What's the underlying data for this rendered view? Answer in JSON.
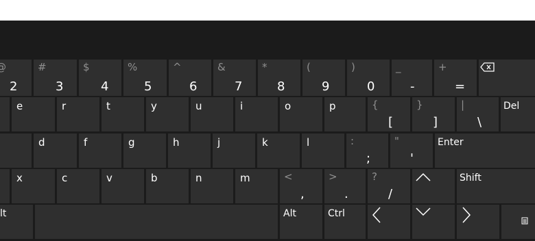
{
  "colors": {
    "background": "#1b1b1b",
    "key": "#2f2f2f",
    "text": "#ffffff",
    "secondary_text": "#8f8f8f"
  },
  "row1": [
    {
      "shift": "@",
      "main": "2"
    },
    {
      "shift": "#",
      "main": "3"
    },
    {
      "shift": "$",
      "main": "4"
    },
    {
      "shift": "%",
      "main": "5"
    },
    {
      "shift": "^",
      "main": "6"
    },
    {
      "shift": "&",
      "main": "7"
    },
    {
      "shift": "*",
      "main": "8"
    },
    {
      "shift": "(",
      "main": "9"
    },
    {
      "shift": ")",
      "main": "0"
    },
    {
      "shift": "_",
      "main": "-"
    },
    {
      "shift": "+",
      "main": "="
    }
  ],
  "backspace_icon": "backspace-icon",
  "row2": [
    "e",
    "r",
    "t",
    "y",
    "u",
    "i",
    "o",
    "p"
  ],
  "row2_symbols": [
    {
      "shift": "{",
      "main": "["
    },
    {
      "shift": "}",
      "main": "]"
    },
    {
      "shift": "|",
      "main": "\\"
    }
  ],
  "row2_del": "Del",
  "row3": [
    "d",
    "f",
    "g",
    "h",
    "j",
    "k",
    "l"
  ],
  "row3_symbols": [
    {
      "shift": ":",
      "main": ";"
    },
    {
      "shift": "\"",
      "main": "'"
    }
  ],
  "row3_enter": "Enter",
  "row4": [
    "x",
    "c",
    "v",
    "b",
    "n",
    "m"
  ],
  "row4_symbols": [
    {
      "shift": "<",
      "main": ","
    },
    {
      "shift": ">",
      "main": "."
    },
    {
      "shift": "?",
      "main": "/"
    }
  ],
  "row4_shift": "Shift",
  "row5_alt_left": "lt",
  "row5_alt": "Alt",
  "row5_ctrl": "Ctrl",
  "row5_icons": [
    "left-arrow-icon",
    "down-arrow-icon",
    "right-arrow-icon",
    "keyboard-menu-icon"
  ],
  "row4_icons": [
    "up-arrow-icon"
  ]
}
